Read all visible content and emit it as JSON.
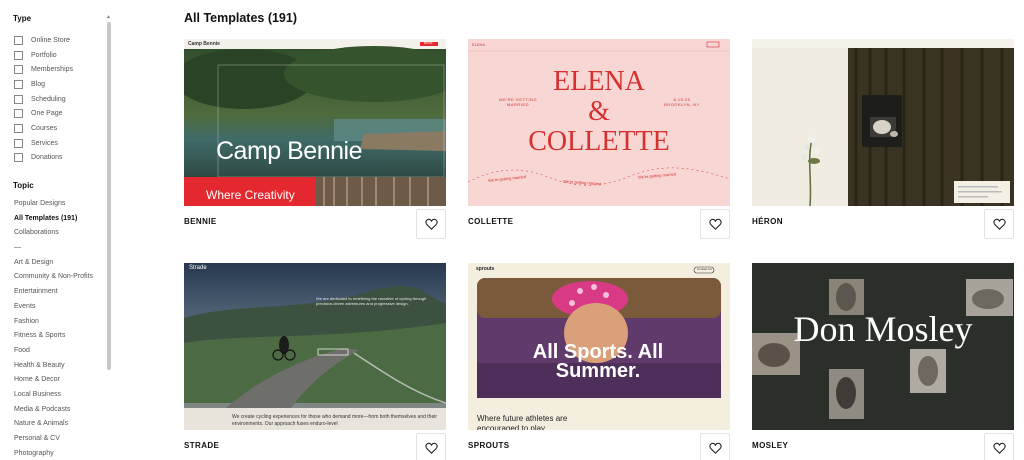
{
  "sidebar": {
    "type_heading": "Type",
    "type_items": [
      "Online Store",
      "Portfolio",
      "Memberships",
      "Blog",
      "Scheduling",
      "One Page",
      "Courses",
      "Services",
      "Donations"
    ],
    "topic_heading": "Topic",
    "topic_items": [
      "Popular Designs",
      "All Templates (191)",
      "Collaborations",
      "—",
      "Art & Design",
      "Community & Non-Profits",
      "Entertainment",
      "Events",
      "Fashion",
      "Fitness & Sports",
      "Food",
      "Health & Beauty",
      "Home & Decor",
      "Local Business",
      "Media & Podcasts",
      "Nature & Animals",
      "Personal & CV",
      "Photography"
    ]
  },
  "main": {
    "title": "All Templates (191)",
    "templates": [
      {
        "name": "BENNIE",
        "brand": "Camp Bennie",
        "headline": "Camp Bennie",
        "tagline": "Where Creativity",
        "cta": "BOOK"
      },
      {
        "name": "COLLETTE",
        "brand": "Elena & Collette",
        "headline_1": "ELENA",
        "headline_2": "&",
        "headline_3": "COLLETTE",
        "left_caption": "WE'RE GETTING MARRIED",
        "right_caption": "6.15.25 BROOKLYN, NY",
        "wave_text": "We're getting married"
      },
      {
        "name": "HÉRON"
      },
      {
        "name": "STRADE",
        "brand": "Strade",
        "paragraph": "We are dedicated to redefining the narrative of cycling through precision-driven adventures and progressive design.",
        "footer_text": "We create cycling experiences for those who demand more—from both themselves and their environments. Our approach fuses enduro-level"
      },
      {
        "name": "SPROUTS",
        "brand": "sprouts",
        "headline": "All Sports. All Summer.",
        "tagline": "Where future athletes are encouraged to play",
        "button": "Contact Us"
      },
      {
        "name": "MOSLEY",
        "headline": "Don Mosley"
      }
    ]
  },
  "icons": {
    "favorite": "heart-outline-icon",
    "checkbox": "checkbox-empty-icon"
  },
  "colors": {
    "collette_bg": "#f7d6d3",
    "collette_accent": "#d6302f",
    "bennie_red": "#e3292f",
    "mosley_bg": "#2a2f2a",
    "sprouts_bg": "#f4eedf"
  }
}
